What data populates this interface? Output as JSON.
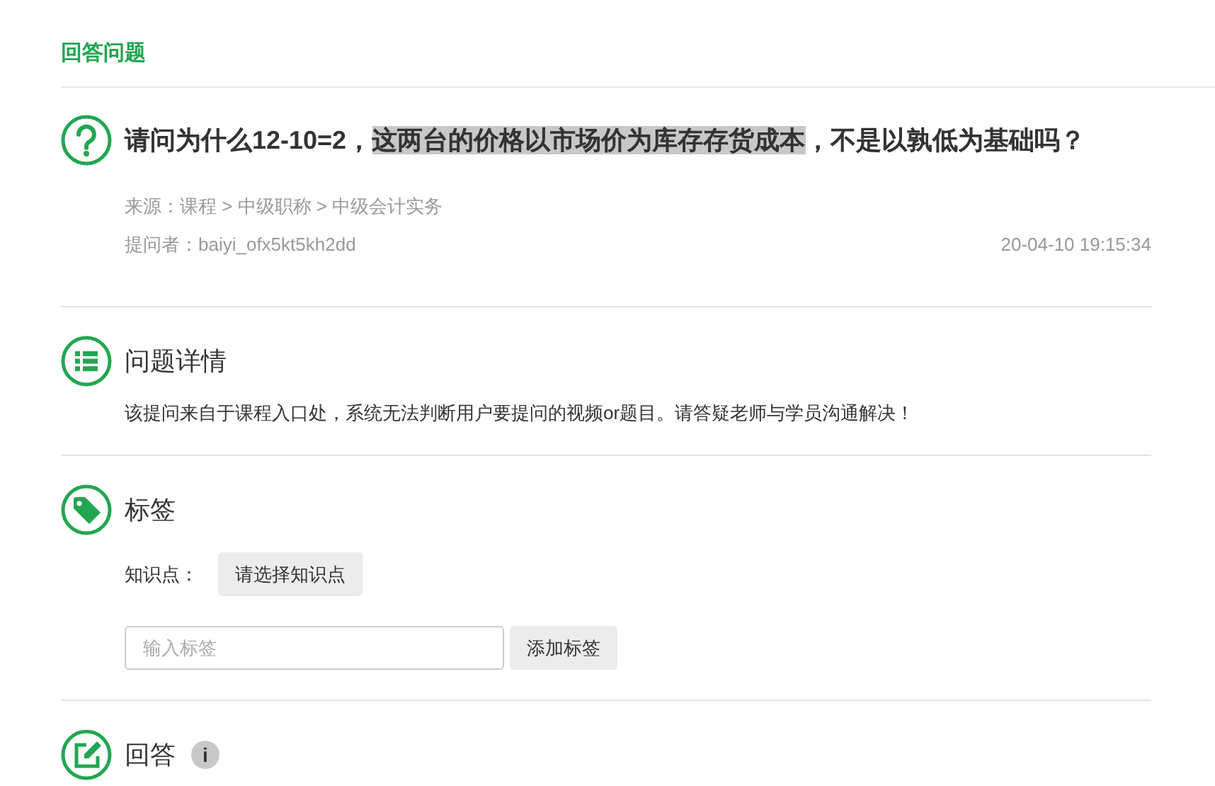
{
  "page_title": "回答问题",
  "question": {
    "segments": [
      {
        "text": "请问为什么12-10=2，",
        "highlighted": false
      },
      {
        "text": "这两台的价格以市场价为库存存货成本",
        "highlighted": true
      },
      {
        "text": "，不是以孰低为基础吗？",
        "highlighted": false
      }
    ],
    "source": "来源：课程 > 中级职称 > 中级会计实务",
    "asker": "提问者：baiyi_ofx5kt5kh2dd",
    "time": "20-04-10 19:15:34"
  },
  "sections": [
    {
      "kind": "details",
      "title": "问题详情",
      "text": "该提问来自于课程入口处，系统无法判断用户要提问的视频or题目。请答疑老师与学员沟通解决！"
    },
    {
      "kind": "tags",
      "title": "标签",
      "knowledge_label": "知识点：",
      "knowledge_button": "请选择知识点",
      "tag_input": {
        "placeholder": "输入标签"
      },
      "add_button": "添加标签"
    },
    {
      "kind": "answer",
      "title": "回答",
      "info": "i"
    }
  ]
}
